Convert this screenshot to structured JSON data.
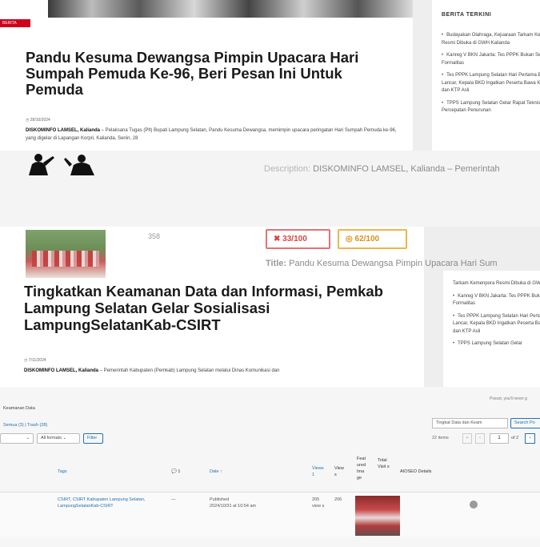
{
  "article1": {
    "tag": "BERITA",
    "title": "Pandu Kesuma Dewangsa Pimpin Upacara Hari Sumpah Pemuda Ke-96, Beri Pesan Ini Untuk Pemuda",
    "date": "28/10/2024",
    "source": "DISKOMINFO LAMSEL, Kalianda",
    "excerpt": " – Pelaksana Tugas (Plt) Bupati Lampung Selatan, Pandu Kesuma Dewangsa, memimpin upacara peringatan Hari Sumpah Pemuda ke-96, yang digelar di Lapangan Korpri, Kalianda, Senin, 28"
  },
  "sidebar": {
    "heading": "BERITA TERKINI",
    "items": [
      "Budayakan Olahraga, Kejuaraan Tarkam Kemenpora Resmi Dibuka di GWH Kalianda",
      "Kanreg V BKN Jakarta: Tes PPPK Bukan Sekadar Formalitas",
      "Tes PPPK Lampung Selatan Hari Pertama Berjalan Lancar, Kepala BKD Ingatkan Peserta Bawa Kartu Ujian dan KTP Asli",
      "TPPS Lampung Selatan Gelar Rapat Teknis Percepatan Penurunan"
    ]
  },
  "seo": {
    "description_label": "Description:",
    "description_text": " DISKOMINFO LAMSEL, Kalianda – Pemerintah",
    "count": "358",
    "score_seo": "33/100",
    "score_readability": "62/100",
    "title_label": "Title:",
    "title_text": " Pandu Kesuma Dewangsa Pimpin Upacara Hari Sum"
  },
  "article2": {
    "title": "Tingkatkan Keamanan Data dan Informasi, Pemkab Lampung Selatan Gelar Sosialisasi LampungSelatanKab-CSIRT",
    "date": "7/11/2024",
    "source": "DISKOMINFO LAMSEL, Kalianda",
    "excerpt": " – Pemerintah Kabupaten (Pemkab) Lampung Selatan melalui Dinas Komunikasi dan"
  },
  "sidebar2": {
    "items": [
      "Tarkam Kemenpora Resmi Dibuka di GWH Kalianda",
      "Kanreg V BKN Jakarta: Tes PPPK Bukan Sekadar Formalitas",
      "Tes PPPK Lampung Selatan Hari Pertama Berjalan Lancar, Kepala BKD Ingatkan Peserta Bawa Kartu Ujian dan KTP Asli",
      "TPPS Lampung Selatan Gelar"
    ]
  },
  "admin": {
    "page_title": "Keamanan Data",
    "notice": "Psssst, you'll never g",
    "views": "Semua (3) | Trash (28)",
    "bulk_select": "",
    "format_select": "All formats",
    "filter_button": "Filter",
    "search_value": "Tingkat Data dan Keam",
    "search_button": "Search Po",
    "items_count": "22 items",
    "pg_first": "«",
    "pg_prev": "‹",
    "pg_current": "1",
    "pg_of": "of 2",
    "pg_next": "›",
    "columns": {
      "tags": "Tags",
      "comments": "💬 1",
      "date": "Date ↑",
      "views": "Views 1",
      "view_s": "View s",
      "featured": "Feat ured Ima ge",
      "total_visit": "Total Visit s",
      "aioseo": "AIOSEO Details"
    },
    "row": {
      "tags": "CSIRT, CSIRT Kabupaten Lampung Selatan, LampungSelatanKab-CSIRT",
      "comments": "—",
      "date_status": "Published",
      "date_value": "2024/10/31 at 10:54 am",
      "views": "205 view s",
      "total": "206"
    }
  }
}
